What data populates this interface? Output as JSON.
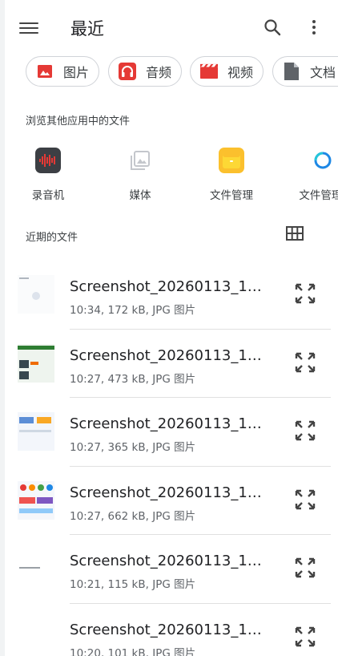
{
  "appbar": {
    "title": "最近",
    "menu_icon": "menu-icon",
    "search_icon": "search-icon",
    "more_icon": "more-vert-icon"
  },
  "chips": [
    {
      "label": "图片",
      "icon": "image-icon",
      "color": "#e53935"
    },
    {
      "label": "音频",
      "icon": "headphones-icon",
      "color": "#e53935"
    },
    {
      "label": "视频",
      "icon": "clapperboard-icon",
      "color": "#e53935"
    },
    {
      "label": "文档",
      "icon": "document-icon",
      "color": "#5f6368"
    }
  ],
  "browse_section": {
    "title": "浏览其他应用中的文件"
  },
  "apps": [
    {
      "label": "录音机",
      "icon": "waveform-icon"
    },
    {
      "label": "媒体",
      "icon": "gallery-icon"
    },
    {
      "label": "文件管理",
      "icon": "folder-app-icon"
    },
    {
      "label": "文件管理(",
      "icon": "file-manager-icon"
    }
  ],
  "recent_section": {
    "title": "近期的文件",
    "grid_icon": "grid-view-icon"
  },
  "files": [
    {
      "name": "Screenshot_20260113_1…",
      "meta": "10:34, 172 kB, JPG 图片"
    },
    {
      "name": "Screenshot_20260113_1…",
      "meta": "10:27, 473 kB, JPG 图片"
    },
    {
      "name": "Screenshot_20260113_1…",
      "meta": "10:27, 365 kB, JPG 图片"
    },
    {
      "name": "Screenshot_20260113_1…",
      "meta": "10:27, 662 kB, JPG 图片"
    },
    {
      "name": "Screenshot_20260113_1…",
      "meta": "10:21, 115 kB, JPG 图片"
    },
    {
      "name": "Screenshot_20260113_1…",
      "meta": "10:20, 101 kB, JPG 图片"
    }
  ]
}
